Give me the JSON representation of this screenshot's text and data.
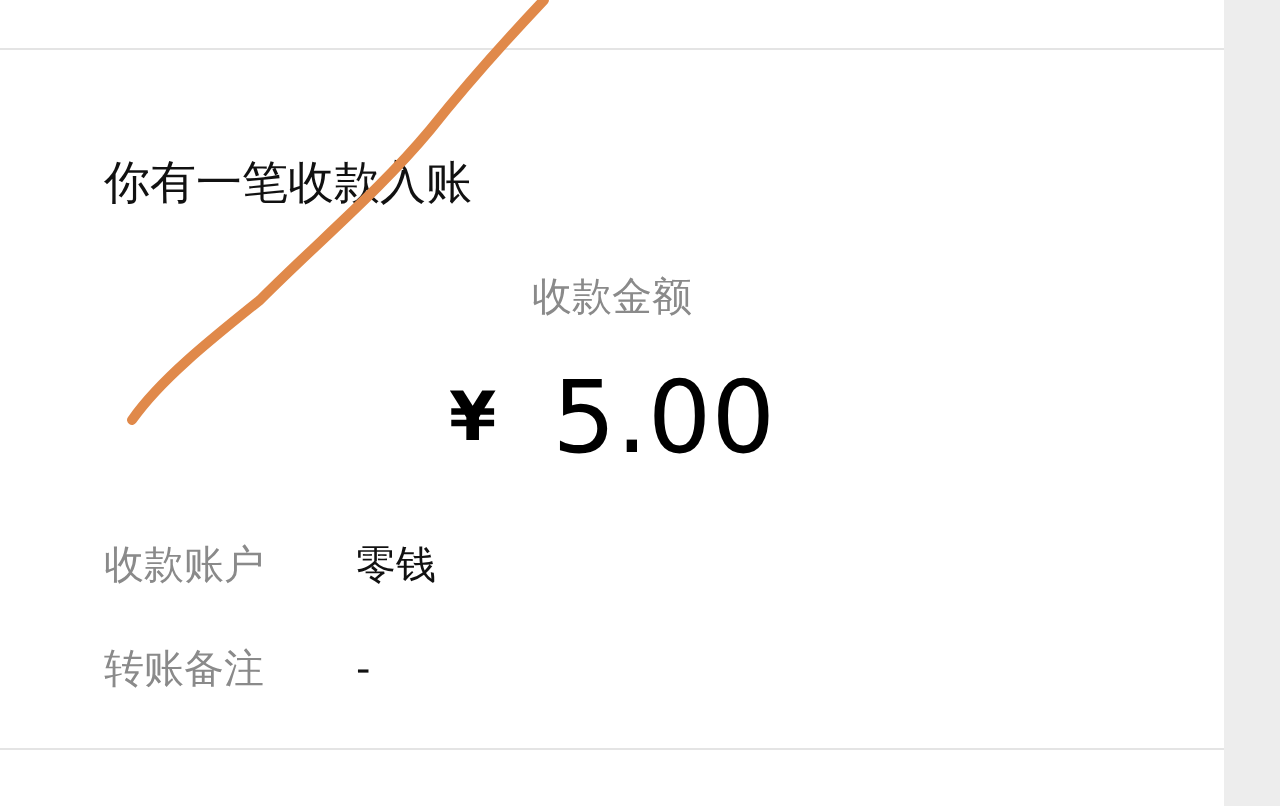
{
  "notice": {
    "title": "你有一笔收款入账",
    "amount_label": "收款金额",
    "currency": "¥",
    "amount": "5.00",
    "rows": [
      {
        "label": "收款账户",
        "value": "零钱"
      },
      {
        "label": "转账备注",
        "value": "-"
      }
    ]
  }
}
